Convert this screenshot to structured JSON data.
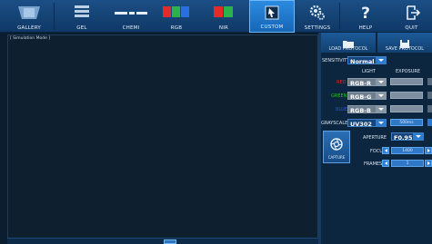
{
  "toolbar": {
    "buttons": [
      {
        "label": "GALLERY",
        "icon": "gallery-icon"
      },
      {
        "label": "GEL",
        "icon": "gel-icon"
      },
      {
        "label": "CHEMI",
        "icon": "chemi-icon"
      },
      {
        "label": "RGB",
        "icon": "rgb-icon"
      },
      {
        "label": "NIR",
        "icon": "nir-icon"
      },
      {
        "label": "CUSTOM",
        "icon": "custom-icon",
        "active": true
      },
      {
        "label": "SETTINGS",
        "icon": "settings-icon"
      },
      {
        "label": "HELP",
        "icon": "help-icon"
      },
      {
        "label": "QUIT",
        "icon": "quit-icon"
      }
    ]
  },
  "view": {
    "title": "[ Simulation Mode ]"
  },
  "panel": {
    "load_protocol": "LOAD PROTOCOL",
    "save_protocol": "SAVE PROTOCOL",
    "sensitivity_label": "SENSITIVITY",
    "sensitivity_value": "Normal",
    "light_header": "LIGHT",
    "exposure_header": "EXPOSURE",
    "channels": [
      {
        "label": "RED",
        "color": "#e02020",
        "value": "RGB-R",
        "exposure": ""
      },
      {
        "label": "GREEN",
        "color": "#22c022",
        "value": "RGB-G",
        "exposure": ""
      },
      {
        "label": "BLUE",
        "color": "#2a4cff",
        "value": "RGB-B",
        "exposure": ""
      },
      {
        "label": "GRAYSCALE",
        "color": "#ffffff",
        "value": "UV302",
        "exposure": "500ms"
      }
    ],
    "aperture_label": "APERTURE",
    "aperture_value": "F0.95",
    "focus_label": "FOCUS",
    "focus_value": "1400",
    "frames_label": "FRAMES",
    "frames_value": "1",
    "capture_label": "CAPTURE"
  },
  "colors": {
    "accent": "#2b8be0",
    "toolbar": "#1b4f86",
    "background": "#0b1e2f"
  }
}
